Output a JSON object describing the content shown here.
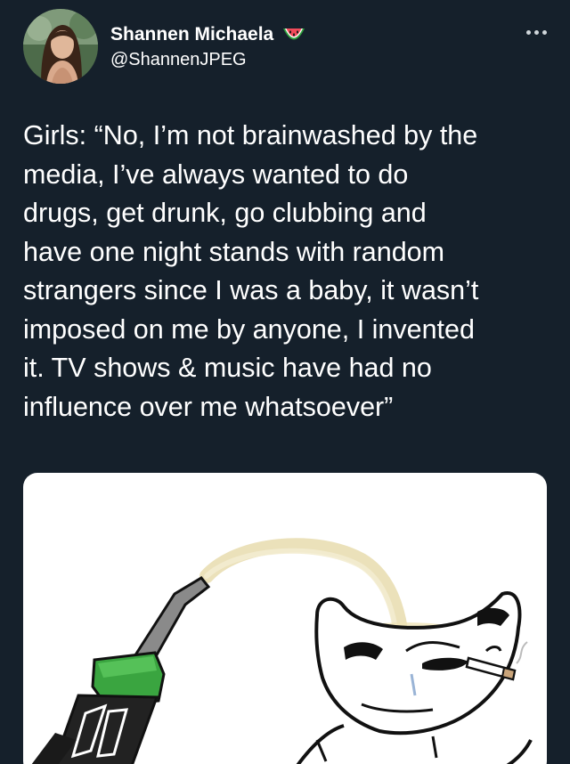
{
  "user": {
    "display_name": "Shannen Michaela",
    "name_emoji": "watermelon-icon",
    "handle": "@ShannenJPEG"
  },
  "menu": {
    "more_icon": "more-horizontal-icon"
  },
  "tweet": {
    "lines": [
      "Girls: “No, I’m not brainwashed by the",
      "media, I’ve always wanted to do",
      "drugs, get drunk, go clubbing and",
      "have one night stands with random",
      "strangers since I was a baby, it wasn’t",
      "imposed on me by anyone, I invented",
      "it. TV shows & music have had no",
      "influence over me whatsoever”"
    ]
  },
  "media": {
    "image": "meme-fuel-nozzle-pouring-into-brainless-wojak-head",
    "icons": [
      "fuel-nozzle-icon",
      "wojak-face-icon",
      "cigarette-icon"
    ]
  },
  "colors": {
    "background": "#15202b",
    "text": "#ffffff",
    "nozzle_green": "#3aa540",
    "fuel_stream": "#e6d9a8"
  }
}
